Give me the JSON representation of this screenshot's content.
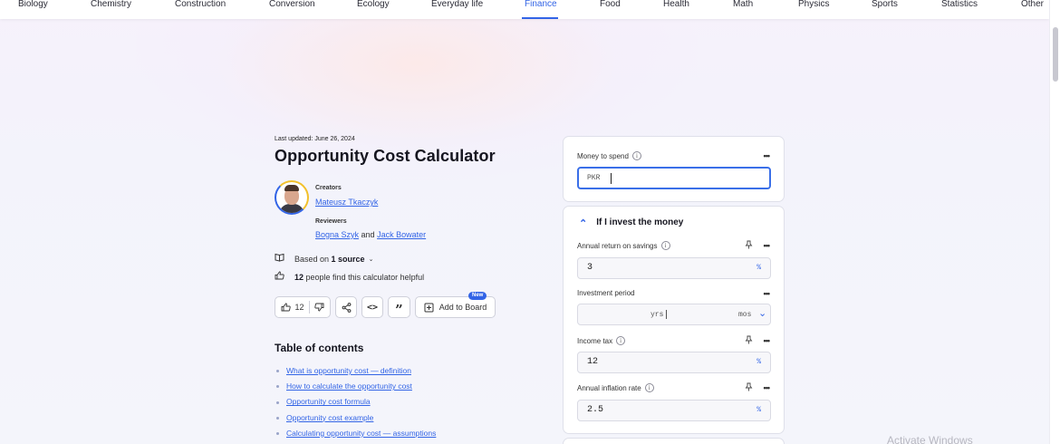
{
  "nav": {
    "items": [
      "Biology",
      "Chemistry",
      "Construction",
      "Conversion",
      "Ecology",
      "Everyday life",
      "Finance",
      "Food",
      "Health",
      "Math",
      "Physics",
      "Sports",
      "Statistics",
      "Other"
    ],
    "active": "Finance"
  },
  "page": {
    "last_updated": "Last updated: June 26, 2024",
    "title": "Opportunity Cost Calculator",
    "creators_label": "Creators",
    "creator": "Mateusz Tkaczyk",
    "reviewers_label": "Reviewers",
    "reviewer1": "Bogna Szyk",
    "reviewers_and": "and",
    "reviewer2": "Jack Bowater",
    "based_on_prefix": "Based on",
    "based_on_count": "1 source",
    "helpful_count": "12",
    "helpful_text": "people find this calculator helpful"
  },
  "actions": {
    "like_count": "12",
    "add_to_board": "Add to Board",
    "new_badge": "New"
  },
  "toc": {
    "title": "Table of contents",
    "items": [
      "What is opportunity cost — definition",
      "How to calculate the opportunity cost",
      "Opportunity cost formula",
      "Opportunity cost example",
      "Calculating opportunity cost — assumptions"
    ]
  },
  "calculator": {
    "money_label": "Money to spend",
    "money_currency": "PKR",
    "money_value": "",
    "section_title": "If I invest the money",
    "annual_return_label": "Annual return on savings",
    "annual_return_value": "3",
    "percent_unit": "%",
    "investment_period_label": "Investment period",
    "investment_period_unit_yrs": "yrs",
    "investment_period_unit_mos": "mos",
    "income_tax_label": "Income tax",
    "income_tax_value": "12",
    "inflation_label": "Annual inflation rate",
    "inflation_value": "2.5"
  },
  "watermark": "Activate Windows",
  "colors": {
    "accent": "#3264e6",
    "background": "#f4f4fb"
  }
}
